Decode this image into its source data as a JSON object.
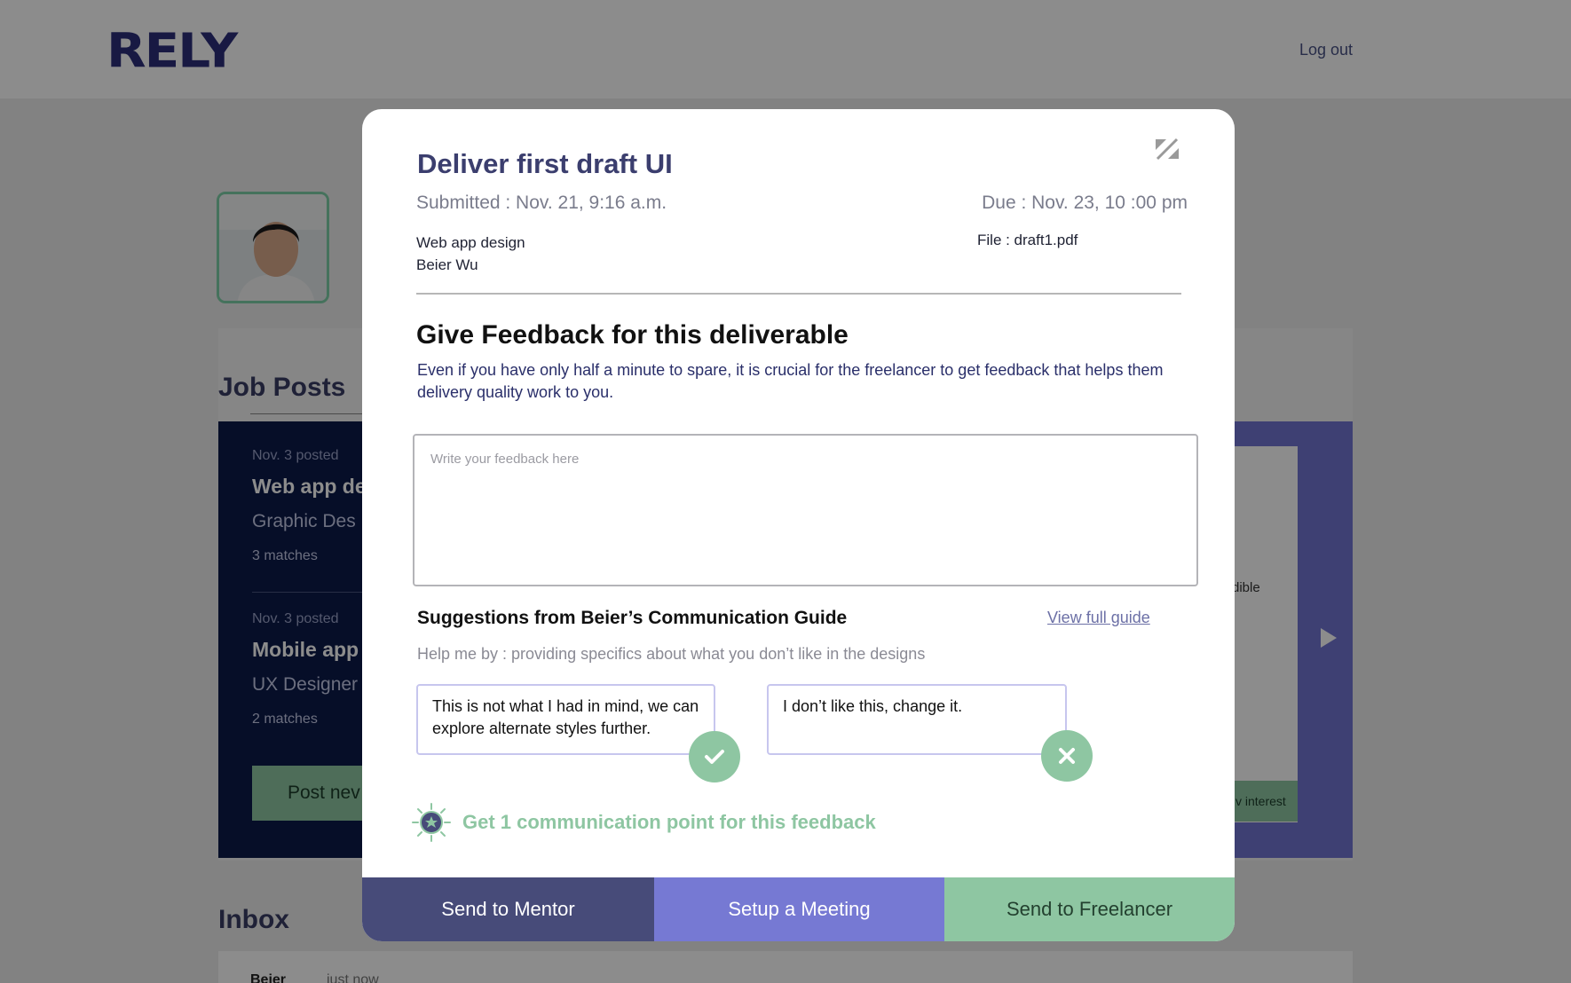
{
  "app": {
    "logo": "RELY",
    "logout_label": "Log out"
  },
  "jobposts": {
    "title": "Job Posts",
    "jobs": [
      {
        "posted": "Nov. 3 posted",
        "title": "Web app de",
        "subtitle": "Graphic Des",
        "matches": "3 matches"
      },
      {
        "posted": "Nov. 3 posted",
        "title": "Mobile app",
        "subtitle": "UX Designer",
        "matches": "2 matches"
      }
    ],
    "post_new_label": "Post nev",
    "right_text": "dible",
    "right_button_label": "v interest"
  },
  "inbox": {
    "title": "Inbox",
    "first_sender": "Beier",
    "first_time": "just now"
  },
  "modal": {
    "title": "Deliver first draft UI",
    "submitted": "Submitted : Nov. 21, 9:16 a.m.",
    "due": "Due : Nov. 23, 10 :00 pm",
    "project": "Web app design",
    "freelancer": "Beier Wu",
    "file": "File : draft1.pdf",
    "feedback_heading": "Give Feedback for this deliverable",
    "feedback_description": "Even if you have only half a minute to spare, it is crucial for the freelancer to get feedback that helps them delivery quality work to you.",
    "feedback_placeholder": "Write your feedback here",
    "suggestions_title": "Suggestions from Beier’s Communication Guide",
    "view_guide_label": "View full guide",
    "help_text": "Help me by : providing specifics about what you don’t like in the designs",
    "suggestion_good": "This is not what I had in mind, we can explore alternate styles further.",
    "suggestion_bad": "I don’t like this, change it.",
    "points_text": "Get 1 communication point for this feedback",
    "buttons": {
      "send_mentor": "Send to Mentor",
      "setup_meeting": "Setup a Meeting",
      "send_freelancer": "Send to Freelancer"
    }
  },
  "colors": {
    "navy": "#474b79",
    "periwinkle": "#7679d3",
    "mint": "#8ec6a2",
    "dark_card": "#0b1a4a"
  }
}
